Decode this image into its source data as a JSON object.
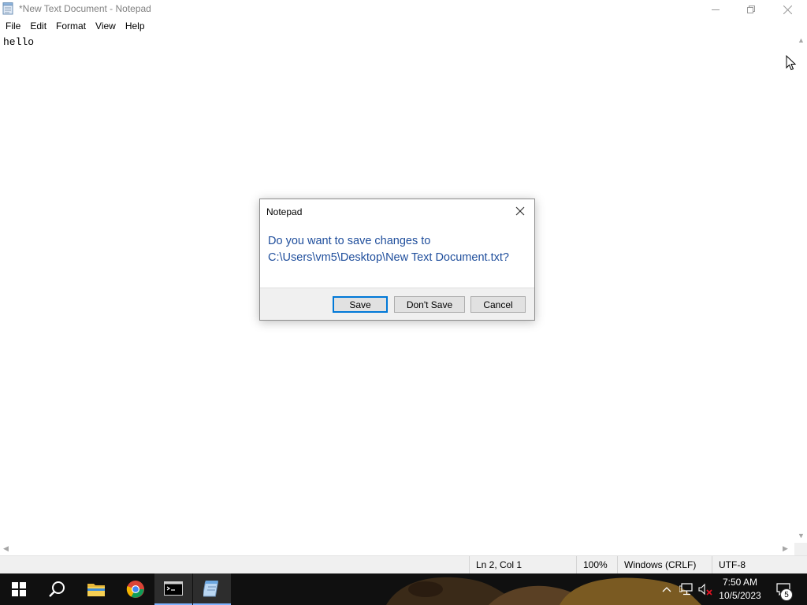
{
  "window": {
    "title": "*New Text Document - Notepad",
    "icon": "notepad-icon"
  },
  "menu": {
    "items": [
      "File",
      "Edit",
      "Format",
      "View",
      "Help"
    ]
  },
  "editor": {
    "content": "hello"
  },
  "status": {
    "position": "Ln 2, Col 1",
    "zoom": "100%",
    "line_ending": "Windows (CRLF)",
    "encoding": "UTF-8"
  },
  "dialog": {
    "title": "Notepad",
    "message_line1": "Do you want to save changes to",
    "message_line2": "C:\\Users\\vm5\\Desktop\\New Text Document.txt?",
    "buttons": {
      "save": "Save",
      "dont_save": "Don't Save",
      "cancel": "Cancel"
    }
  },
  "taskbar": {
    "apps": [
      "start-icon",
      "search-icon",
      "file-explorer-icon",
      "chrome-icon",
      "terminal-icon",
      "notepad-icon"
    ],
    "clock_time": "7:50 AM",
    "clock_date": "10/5/2023",
    "notification_count": "5"
  },
  "colors": {
    "accent": "#0078d7",
    "dialog_message": "#1f4e9c",
    "taskbar": "#101010"
  }
}
